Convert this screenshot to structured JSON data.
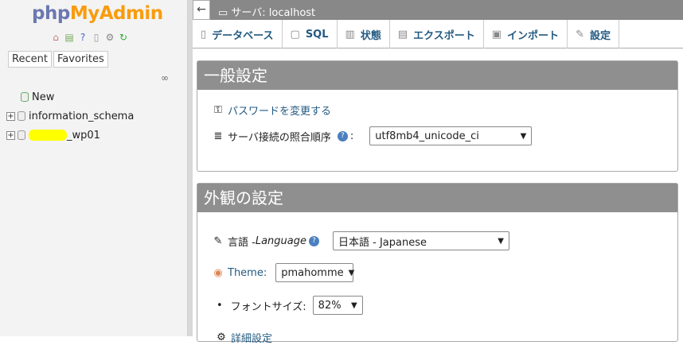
{
  "logo": {
    "php": "php",
    "myadmin": "MyAdmin"
  },
  "nav_icons": [
    "home-icon",
    "exit-icon",
    "help-icon",
    "docs-icon",
    "settings-icon",
    "reload-icon"
  ],
  "tabs": {
    "recent": "Recent",
    "favorites": "Favorites"
  },
  "tree": {
    "new": "New",
    "db1": "information_schema",
    "db2_suffix": "_wp01"
  },
  "topbar": {
    "back": "←",
    "server": "サーバ: localhost"
  },
  "menu": [
    {
      "label": "データベース",
      "icon": "database-icon"
    },
    {
      "label": "SQL",
      "icon": "sql-icon"
    },
    {
      "label": "状態",
      "icon": "status-icon"
    },
    {
      "label": "エクスポート",
      "icon": "export-icon"
    },
    {
      "label": "インポート",
      "icon": "import-icon"
    },
    {
      "label": "設定",
      "icon": "wrench-icon"
    }
  ],
  "general": {
    "title": "一般設定",
    "password_link": "パスワードを変更する",
    "collation_label": "サーバ接続の照合順序",
    "collation_value": "utf8mb4_unicode_ci"
  },
  "appearance": {
    "title": "外観の設定",
    "language_label": "言語 - ",
    "language_italic": "Language",
    "language_value": "日本語 - Japanese",
    "theme_label": "Theme:",
    "theme_value": "pmahomme",
    "font_label": "フォントサイズ:",
    "font_value": "82%",
    "more_label": "詳細設定"
  }
}
